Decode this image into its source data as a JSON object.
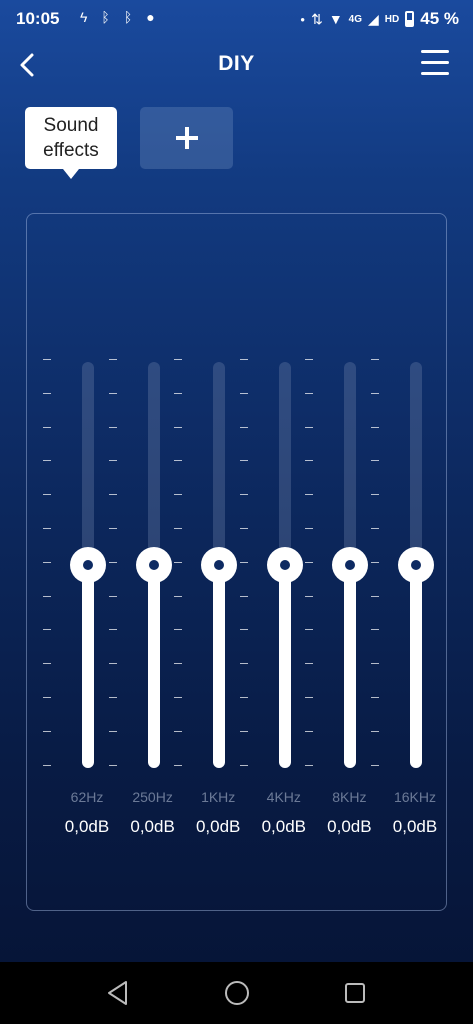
{
  "status_bar": {
    "time": "10:05",
    "network": "4G",
    "network_sub": "1↓",
    "hd": "HD",
    "battery": "45 %"
  },
  "header": {
    "title": "DIY"
  },
  "presets": {
    "active_label": "Sound effects",
    "add_label": "+"
  },
  "eq": {
    "bands": [
      {
        "freq": "62Hz",
        "gain": "0,0dB",
        "level": 0.5
      },
      {
        "freq": "250Hz",
        "gain": "0,0dB",
        "level": 0.5
      },
      {
        "freq": "1KHz",
        "gain": "0,0dB",
        "level": 0.5
      },
      {
        "freq": "4KHz",
        "gain": "0,0dB",
        "level": 0.5
      },
      {
        "freq": "8KHz",
        "gain": "0,0dB",
        "level": 0.5
      },
      {
        "freq": "16KHz",
        "gain": "0,0dB",
        "level": 0.5
      }
    ]
  },
  "icons": {
    "back": "chevron-left-icon",
    "menu": "hamburger-menu-icon",
    "nav_back": "triangle-back-icon",
    "nav_home": "circle-home-icon",
    "nav_recent": "square-recent-icon"
  }
}
